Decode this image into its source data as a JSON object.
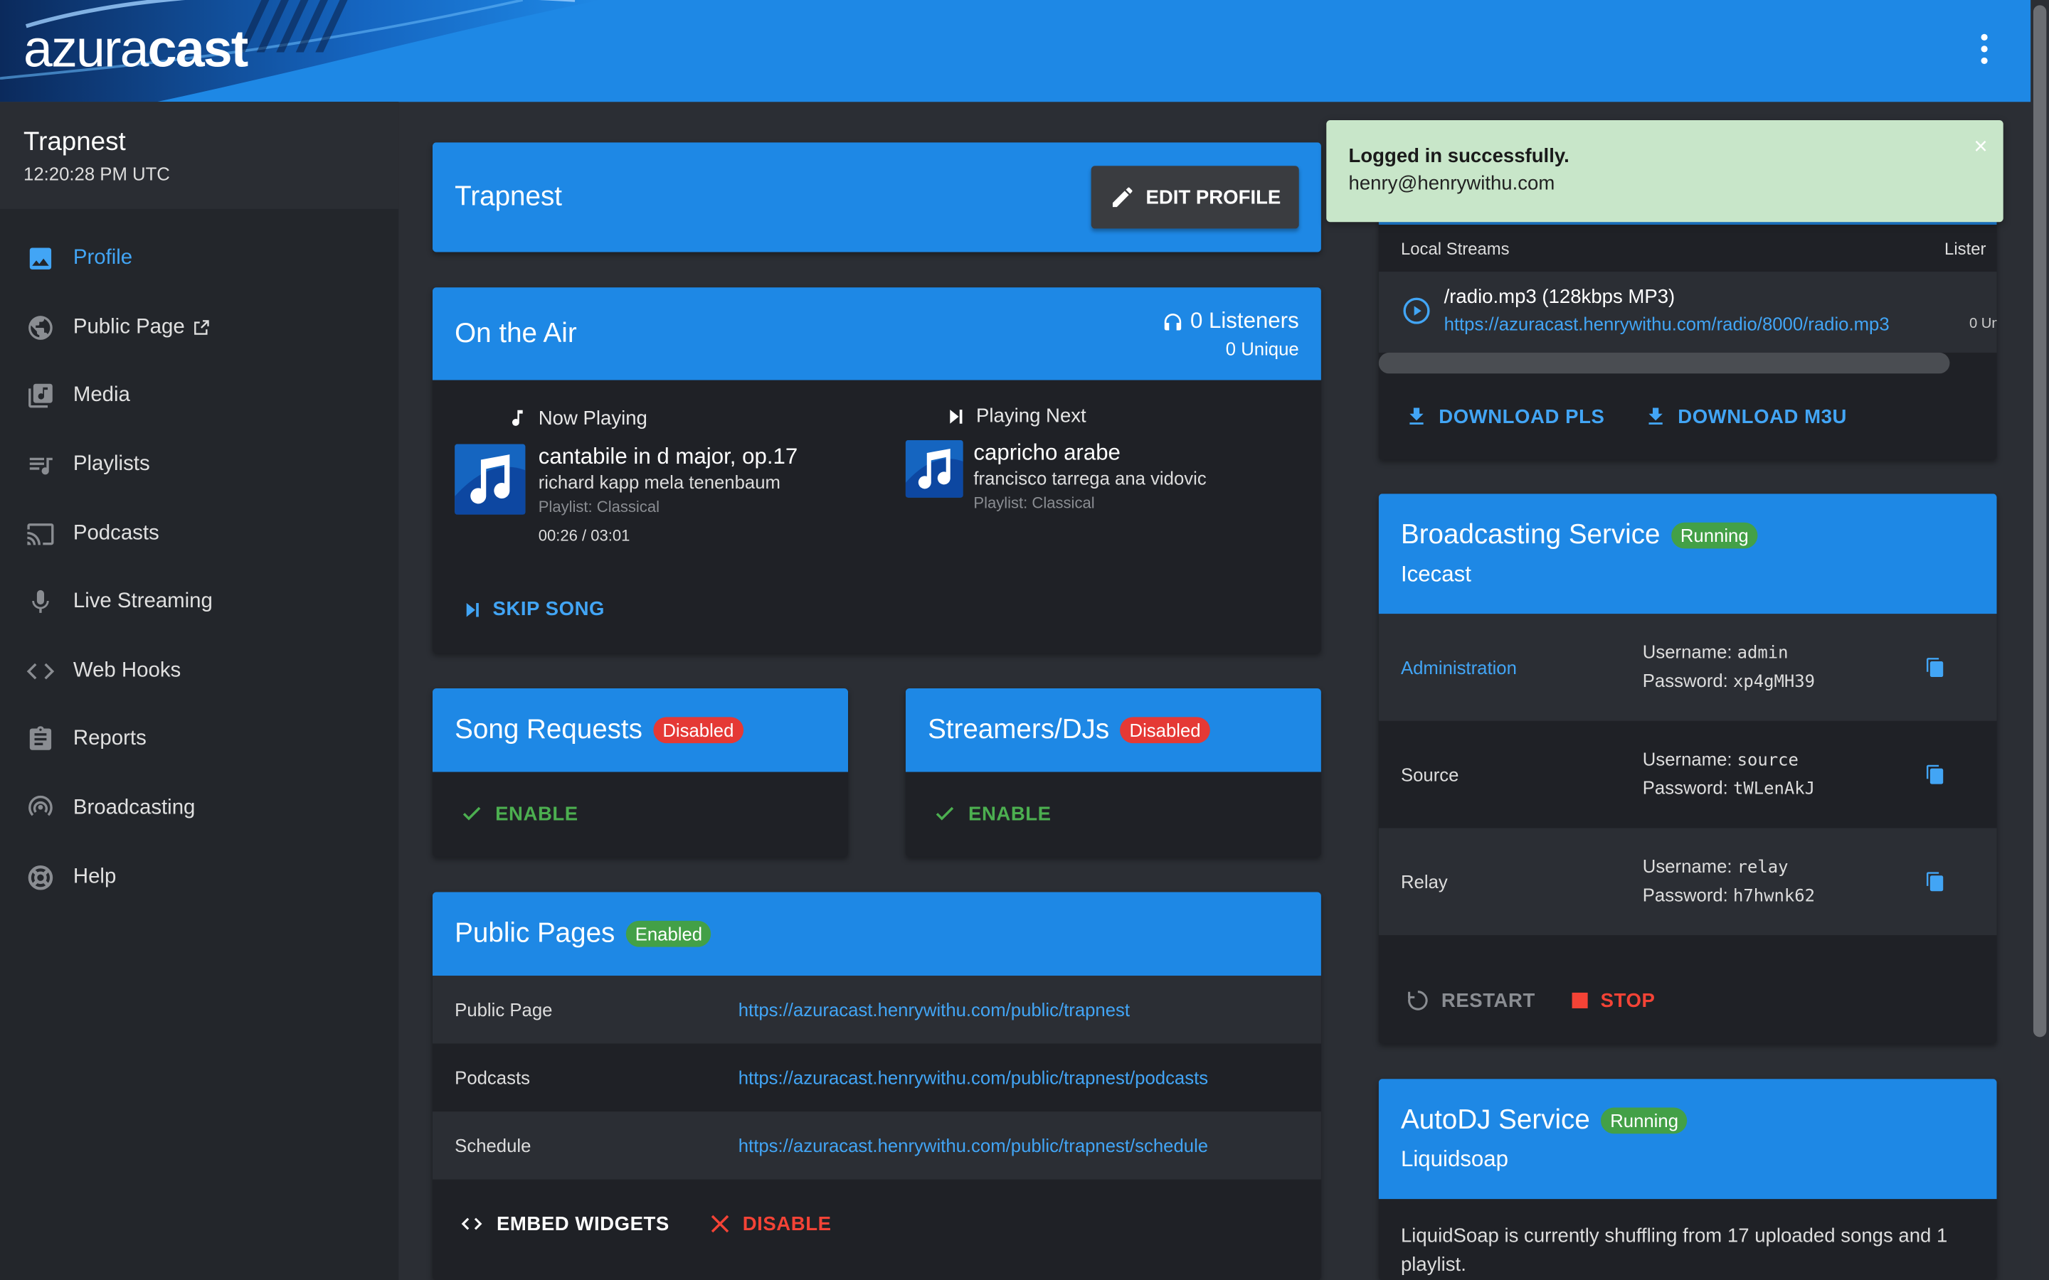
{
  "header": {
    "logo_light": "azura",
    "logo_bold": "cast"
  },
  "station": {
    "name": "Trapnest",
    "time": "12:20:28 PM UTC"
  },
  "nav": [
    {
      "label": "Profile",
      "icon": "image-icon"
    },
    {
      "label": "Public Page",
      "icon": "globe-icon"
    },
    {
      "label": "Media",
      "icon": "music-library-icon"
    },
    {
      "label": "Playlists",
      "icon": "playlist-icon"
    },
    {
      "label": "Podcasts",
      "icon": "cast-icon"
    },
    {
      "label": "Live Streaming",
      "icon": "microphone-icon"
    },
    {
      "label": "Web Hooks",
      "icon": "code-icon"
    },
    {
      "label": "Reports",
      "icon": "clipboard-icon"
    },
    {
      "label": "Broadcasting",
      "icon": "broadcast-icon"
    },
    {
      "label": "Help",
      "icon": "lifebuoy-icon"
    }
  ],
  "profile": {
    "title": "Trapnest",
    "edit_label": "EDIT PROFILE"
  },
  "on_air": {
    "title": "On the Air",
    "listeners": "0 Listeners",
    "unique": "0 Unique",
    "now_playing_label": "Now Playing",
    "now_title": "cantabile in d major, op.17",
    "now_artist": "richard kapp mela tenenbaum",
    "now_playlist": "Playlist: Classical",
    "now_time": "00:26 / 03:01",
    "next_label": "Playing Next",
    "next_title": "capricho arabe",
    "next_artist": "francisco tarrega ana vidovic",
    "next_playlist": "Playlist: Classical",
    "skip_label": "SKIP SONG"
  },
  "song_requests": {
    "title": "Song Requests",
    "badge": "Disabled",
    "action": "ENABLE"
  },
  "streamers": {
    "title": "Streamers/DJs",
    "badge": "Disabled",
    "action": "ENABLE"
  },
  "public_pages": {
    "title": "Public Pages",
    "badge": "Enabled",
    "rows": [
      {
        "label": "Public Page",
        "url": "https://azuracast.henrywithu.com/public/trapnest"
      },
      {
        "label": "Podcasts",
        "url": "https://azuracast.henrywithu.com/public/trapnest/podcasts"
      },
      {
        "label": "Schedule",
        "url": "https://azuracast.henrywithu.com/public/trapnest/schedule"
      }
    ],
    "embed_label": "EMBED WIDGETS",
    "disable_label": "DISABLE"
  },
  "streams": {
    "col1": "Local Streams",
    "col2": "Lister",
    "name": "/radio.mp3 (128kbps MP3)",
    "url": "https://azuracast.henrywithu.com/radio/8000/radio.mp3",
    "count": "0 Un",
    "download_pls": "DOWNLOAD PLS",
    "download_m3u": "DOWNLOAD M3U"
  },
  "broadcasting": {
    "title": "Broadcasting Service",
    "badge": "Running",
    "subtitle": "Icecast",
    "rows": [
      {
        "label": "Administration",
        "username": "admin",
        "password": "xp4gMH39",
        "link": true
      },
      {
        "label": "Source",
        "username": "source",
        "password": "tWLenAkJ",
        "link": false
      },
      {
        "label": "Relay",
        "username": "relay",
        "password": "h7hwnk62",
        "link": false
      }
    ],
    "username_label": "Username:",
    "password_label": "Password:",
    "restart_label": "RESTART",
    "stop_label": "STOP"
  },
  "autodj": {
    "title": "AutoDJ Service",
    "badge": "Running",
    "subtitle": "Liquidsoap",
    "text": "LiquidSoap is currently shuffling from 17 uploaded songs and 1 playlist."
  },
  "toast": {
    "title": "Logged in successfully.",
    "email": "henry@henrywithu.com",
    "close": "×"
  }
}
